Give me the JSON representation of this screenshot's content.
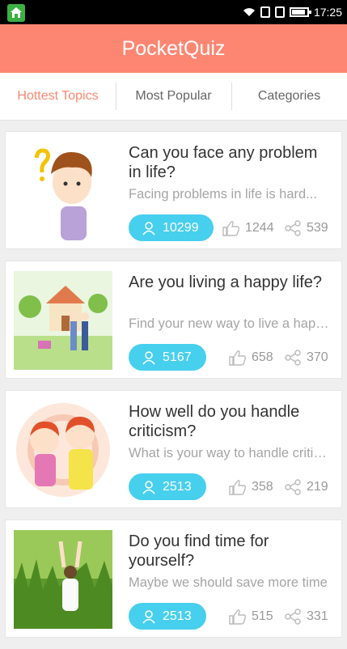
{
  "status": {
    "time": "17:25",
    "battery_level": 0.9
  },
  "app": {
    "title": "PocketQuiz"
  },
  "tabs": [
    {
      "label": "Hottest Topics",
      "active": true
    },
    {
      "label": "Most Popular",
      "active": false
    },
    {
      "label": "Categories",
      "active": false
    }
  ],
  "quizzes": [
    {
      "title": "Can you face any problem in life?",
      "desc": "Facing problems in life is hard...",
      "participants": "10299",
      "likes": "1244",
      "shares": "539"
    },
    {
      "title": "Are you living a happy life?",
      "desc": "Find your new way to live a happy life",
      "participants": "5167",
      "likes": "658",
      "shares": "370"
    },
    {
      "title": "How well do you handle criticism?",
      "desc": "What is your way to handle criticism",
      "participants": "2513",
      "likes": "358",
      "shares": "219"
    },
    {
      "title": "Do you find time for yourself?",
      "desc": "Maybe we should save more time",
      "participants": "2513",
      "likes": "515",
      "shares": "331"
    }
  ]
}
